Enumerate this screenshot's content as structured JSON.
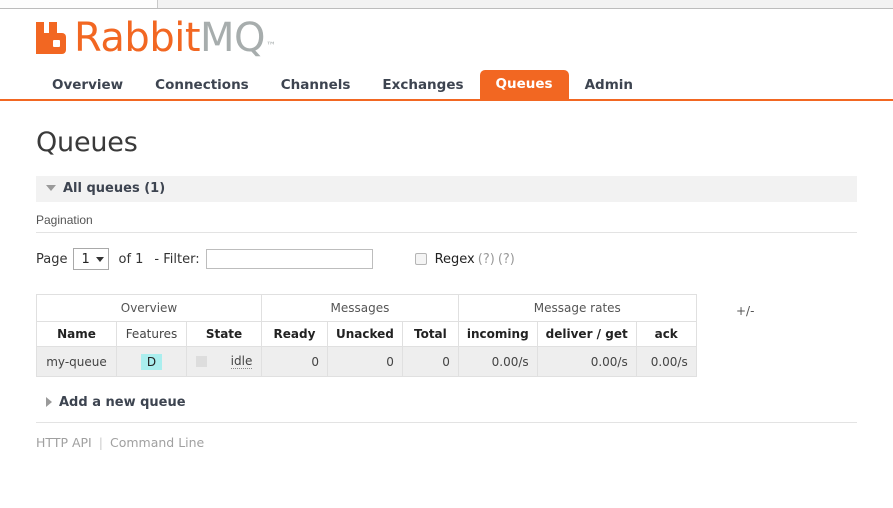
{
  "brand": {
    "name_first": "Rabbit",
    "name_second": "MQ",
    "trademark": "™",
    "logo_icon": "rabbitmq-logo-icon",
    "orange": "#f26722",
    "gray": "#a7adad"
  },
  "nav": {
    "items": [
      {
        "label": "Overview",
        "active": false
      },
      {
        "label": "Connections",
        "active": false
      },
      {
        "label": "Channels",
        "active": false
      },
      {
        "label": "Exchanges",
        "active": false
      },
      {
        "label": "Queues",
        "active": true
      },
      {
        "label": "Admin",
        "active": false
      }
    ]
  },
  "page": {
    "title": "Queues"
  },
  "all_queues": {
    "label": "All queues (1)",
    "expanded": true,
    "toggle_icon": "triangle-down-icon"
  },
  "pagination": {
    "heading": "Pagination",
    "page_label": "Page",
    "page_value": "1",
    "page_options": [
      "1"
    ],
    "of_label": "of 1",
    "filter_label": "- Filter:",
    "filter_value": "",
    "filter_placeholder": "",
    "regex_label": "Regex",
    "regex_checked": false,
    "help_link_1": "(?)",
    "help_link_2": "(?)",
    "caret_icon": "caret-down-icon"
  },
  "table": {
    "groups": [
      {
        "label": "Overview",
        "span": 3
      },
      {
        "label": "Messages",
        "span": 3
      },
      {
        "label": "Message rates",
        "span": 3
      }
    ],
    "columns": [
      {
        "label": "Name",
        "sortable": true,
        "align": "center"
      },
      {
        "label": "Features",
        "sortable": false,
        "align": "center"
      },
      {
        "label": "State",
        "sortable": true,
        "align": "center"
      },
      {
        "label": "Ready",
        "sortable": true,
        "align": "right"
      },
      {
        "label": "Unacked",
        "sortable": true,
        "align": "right"
      },
      {
        "label": "Total",
        "sortable": true,
        "align": "right"
      },
      {
        "label": "incoming",
        "sortable": true,
        "align": "right"
      },
      {
        "label": "deliver / get",
        "sortable": true,
        "align": "right"
      },
      {
        "label": "ack",
        "sortable": true,
        "align": "right"
      }
    ],
    "toggle_columns_label": "+/-",
    "rows": [
      {
        "name": "my-queue",
        "features": "D",
        "state": "idle",
        "state_indicator_color": "#dddddd",
        "ready": "0",
        "unacked": "0",
        "total": "0",
        "incoming": "0.00/s",
        "deliver_get": "0.00/s",
        "ack": "0.00/s"
      }
    ]
  },
  "add_queue": {
    "label": "Add a new queue",
    "expanded": false,
    "toggle_icon": "triangle-right-icon"
  },
  "footer": {
    "http_api": "HTTP API",
    "command_line": "Command Line"
  }
}
